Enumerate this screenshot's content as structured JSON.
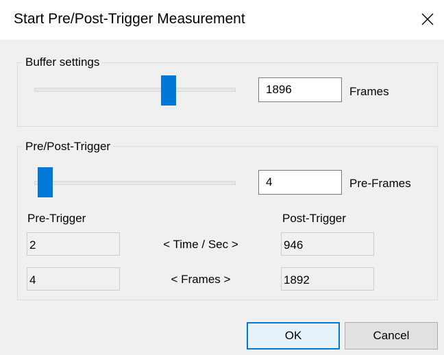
{
  "window": {
    "title": "Start Pre/Post-Trigger Measurement"
  },
  "buffer": {
    "legend": "Buffer settings",
    "slider_fraction": 0.68,
    "value": "1896",
    "unit": "Frames"
  },
  "trigger": {
    "legend": "Pre/Post-Trigger",
    "slider_fraction": 0.02,
    "value": "4",
    "unit": "Pre-Frames",
    "pre_header": "Pre-Trigger",
    "post_header": "Post-Trigger",
    "rows": [
      {
        "pre": "2",
        "label": "< Time / Sec >",
        "post": "946"
      },
      {
        "pre": "4",
        "label": "< Frames >",
        "post": "1892"
      }
    ]
  },
  "buttons": {
    "ok": "OK",
    "cancel": "Cancel"
  },
  "colors": {
    "accent": "#0078d7"
  }
}
